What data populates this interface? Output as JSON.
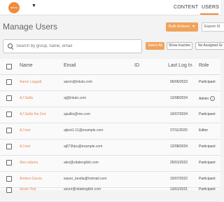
{
  "topbar": {
    "logo_text": "aduro",
    "nav": {
      "content": "CONTENT",
      "users": "USERS"
    }
  },
  "page": {
    "title": "Manage Users",
    "bulk_actions": "Bulk Actions",
    "export": "Export Xl"
  },
  "search": {
    "placeholder": "Search by group, name, email",
    "value": ""
  },
  "filters": {
    "select_all": "Select All",
    "show_inactive": "Show Inactive",
    "no_group": "No Assigned Gr"
  },
  "table": {
    "headers": {
      "name": "Name",
      "email": "Email",
      "id": "ID",
      "last_login": "Last Log In",
      "role": "Role"
    },
    "rows": [
      {
        "name": "Aaron Leggatt",
        "email": "aaron@intuto.com",
        "id": "",
        "last_login": "06/06/2023",
        "role": "Participant"
      },
      {
        "name": "AJ Sallis",
        "email": "aj@intuto.com",
        "id": "",
        "last_login": "12/08/2024",
        "role": "Admin"
      },
      {
        "name": "AJ Sallis the 2nd",
        "email": "ajsallis@me.com",
        "id": "",
        "last_login": "19/07/2024",
        "role": "Participant"
      },
      {
        "name": "AJ test",
        "email": "ajtest1-11@example.com",
        "id": "",
        "last_login": "27/11/2020",
        "role": "Editor"
      },
      {
        "name": "AJ test",
        "email": "aj673hjru@example.com",
        "id": "",
        "last_login": "12/08/2024",
        "role": "Participant"
      },
      {
        "name": "Alex adams",
        "email": "alex@vitalenglish.com",
        "id": "",
        "last_login": "25/01/2022",
        "role": "Participant"
      },
      {
        "name": "Andres Garcia",
        "email": "waser_landia@hotmail.com",
        "id": "",
        "last_login": "15/07/2022",
        "role": "Participant"
      },
      {
        "name": "Azure Test",
        "email": "azure@vitalenglish.com",
        "id": "",
        "last_login": "13/01/2021",
        "role": "Participant"
      }
    ]
  },
  "colors": {
    "accent": "#f08c3c",
    "button_orange": "#f0a35c",
    "link_orange": "#e8865b"
  }
}
